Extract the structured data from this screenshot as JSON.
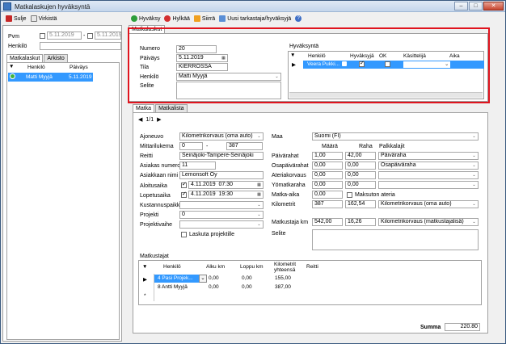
{
  "window": {
    "title": "Matkalaskujen hyväksyntä"
  },
  "left_toolbar": {
    "close_label": "Sulje",
    "refresh_label": "Virkistä"
  },
  "main_toolbar": {
    "approve_label": "Hyväksy",
    "reject_label": "Hylkää",
    "move_label": "Siirrä",
    "new_reviewer_label": "Uusi tarkastaja/hyväksyjä",
    "help_label": "?"
  },
  "filters": {
    "date_label": "Pvm",
    "date_from": "5.11.2019",
    "date_sep": "-",
    "date_to": "5.11.2019",
    "person_label": "Henkilö",
    "person_value": ""
  },
  "left_tabs": [
    "Matkalaskut",
    "Arkisto"
  ],
  "left_grid": {
    "columns": [
      "Henkilö",
      "Päiväys"
    ],
    "rows": [
      {
        "person": "Matti Myyjä",
        "date": "5.11.2019"
      }
    ]
  },
  "main_tab": "Matkalaskut",
  "header_form": {
    "number_label": "Numero",
    "number": "20",
    "date_label": "Päiväys",
    "date": "5.11.2019",
    "status_label": "Tila",
    "status": "KIERROSSA",
    "person_label": "Henkilö",
    "person": "Matti Myyjä",
    "explanation_label": "Selite",
    "explanation": ""
  },
  "approval": {
    "title": "Hyväksyntä",
    "columns": [
      "Henkilö",
      "Hyväksyjä",
      "OK",
      "Käsittelijä",
      "Aika"
    ],
    "rows": [
      {
        "person": "Veera Pukki...",
        "approver": true,
        "ok": false,
        "handler": "",
        "time": ""
      }
    ]
  },
  "trip_tabs": [
    "Matka",
    "Matkalista"
  ],
  "pager": {
    "label": "1/1"
  },
  "trip": {
    "vehicle_label": "Ajoneuvo",
    "vehicle": "Kilometrikorvaus (oma auto)",
    "odometer_label": "Mittarilukema",
    "odometer_start": "0",
    "odometer_sep": "-",
    "odometer_end": "387",
    "route_label": "Reitti",
    "route": "Seinäjoki-Tampere-Seinäjoki",
    "customer_no_label": "Asiakas numero",
    "customer_no": "11",
    "customer_name_label": "Asiakkaan nimi",
    "customer_name": "Lemonsoft Oy",
    "start_label": "Aloitusaika",
    "start_date": "4.11.2019",
    "start_time": "07:30",
    "end_label": "Lopetusaika",
    "end_date": "4.11.2019",
    "end_time": "19:30",
    "cost_center_label": "Kustannuspaikka",
    "cost_center": "",
    "project_label": "Projekti",
    "project": "0",
    "project_phase_label": "Projektivaihe",
    "project_phase": "",
    "bill_project_label": "Laskuta projektille",
    "country_label": "Maa",
    "country": "Suomi (FI)"
  },
  "allowances": {
    "col_amount": "Määrä",
    "col_money": "Raha",
    "col_wage_type": "Palkkalajit",
    "rows": [
      {
        "label": "Päivärahat",
        "amount": "1,00",
        "money": "42,00",
        "wage": "Päiväraha"
      },
      {
        "label": "Osapäivärahat",
        "amount": "0,00",
        "money": "0,00",
        "wage": "Osapäiväraha"
      },
      {
        "label": "Ateriakorvaus",
        "amount": "0,00",
        "money": "0,00",
        "wage": ""
      },
      {
        "label": "Yömatkaraha",
        "amount": "0,00",
        "money": "0,00",
        "wage": ""
      }
    ],
    "travel_time_label": "Matka-aika",
    "travel_time": "0,00",
    "free_meal_label": "Maksuton ateria",
    "km_label": "Kilometrit",
    "km_amount": "387",
    "km_money": "162,54",
    "km_wage": "Kilometrikorvaus (oma auto)",
    "passenger_label": "Matkustaja km",
    "passenger_amount": "542,00",
    "passenger_money": "16,26",
    "passenger_wage": "Kilometrikorvaus (matkustajalisä)",
    "note_label": "Selite",
    "note": ""
  },
  "passengers": {
    "title": "Matkustajat",
    "columns": [
      "Henkilö",
      "Alku km",
      "Loppu km",
      "Kilometrit yhteensä",
      "Reitti"
    ],
    "rows": [
      {
        "person": "4 Pasi Projek...",
        "start": "0,00",
        "end": "0,00",
        "total": "155,00",
        "route": ""
      },
      {
        "person": "8 Antti Myyjä",
        "start": "0,00",
        "end": "0,00",
        "total": "387,00",
        "route": ""
      }
    ]
  },
  "sum": {
    "label": "Summa",
    "value": "220.80"
  }
}
